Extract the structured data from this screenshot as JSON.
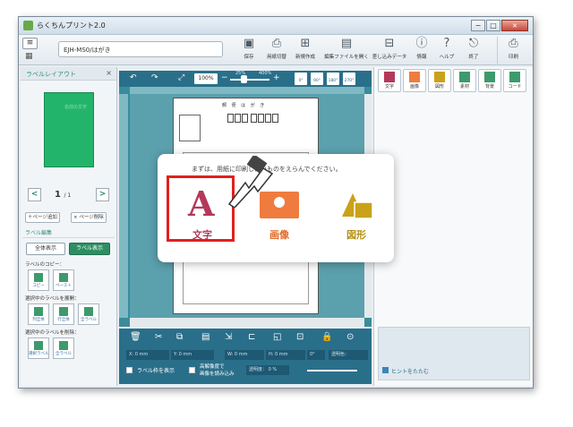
{
  "window": {
    "title": "らくちんプリント2.0",
    "controls": [
      "−",
      "□",
      "×"
    ]
  },
  "toolbar": {
    "media_name": "EJH-MS0/はがき",
    "tools": [
      {
        "label": "保存",
        "icon": "save-icon"
      },
      {
        "label": "用紙切替",
        "icon": "paper-switch-icon"
      },
      {
        "label": "新規作成",
        "icon": "new-file-icon"
      },
      {
        "label": "編集ファイルを開く",
        "icon": "open-file-icon"
      },
      {
        "label": "差し込みデータ",
        "icon": "merge-data-icon"
      },
      {
        "label": "情報",
        "icon": "info-icon"
      },
      {
        "label": "ヘルプ",
        "icon": "help-icon"
      },
      {
        "label": "終了",
        "icon": "exit-icon"
      },
      {
        "label": "印刷",
        "icon": "printer-icon"
      }
    ]
  },
  "left_panel": {
    "title": "ラベルレイアウト",
    "thumb_text": "名前の文字",
    "page_indicator": "1",
    "page_total": "/ 1",
    "add_page": "＋ページ追加",
    "delete_page": "× ページ削除",
    "label_edit_title": "ラベル編集",
    "show_all": "全体表示",
    "show_label": "ラベル表示",
    "label_copy_title": "ラベルのコピー：",
    "copy": "コピー",
    "paste": "ペースト",
    "expand_title": "選択中のラベルを展開：",
    "expand_col": "列全体",
    "expand_row": "行全体",
    "expand_all": "全ラベル",
    "delete_title": "選択中のラベルを削除：",
    "delete_selected": "選択ラベル",
    "delete_all": "全ラベル"
  },
  "canvas": {
    "zoom": "100%",
    "zoom_min": "25%",
    "zoom_max": "400%",
    "rotations": [
      "0°",
      "90°",
      "180°",
      "270°"
    ],
    "paper_title": "郵 便 は が き"
  },
  "bottom_bar": {
    "x_field": "X:     0 mm",
    "y_field": "Y:     0 mm",
    "w_field": "W:     0 mm",
    "h_field": "H:     0 mm",
    "angle_field": "0°",
    "transparent_color": "透明色：",
    "show_label_frame": "ラベル枠を表示",
    "high_density_line1": "高解像度で",
    "high_density_line2": "画像を読み込み",
    "transparency": "透明度：  0 %"
  },
  "right_panel": {
    "tabs": [
      {
        "label": "文字",
        "color": "#b3395b"
      },
      {
        "label": "画像",
        "color": "#f07b3f"
      },
      {
        "label": "図形",
        "color": "#c9a21a"
      },
      {
        "label": "素材",
        "color": "#3d9a6c"
      },
      {
        "label": "背景",
        "color": "#3d9a6c"
      },
      {
        "label": "コード",
        "color": "#3d9a6c"
      }
    ],
    "hint_toggle": "ヒントをたたむ"
  },
  "dialog": {
    "message": "まずは、用紙に印刷したいものをえらんでください。",
    "choices": [
      {
        "label": "文字",
        "color": "#b3395b"
      },
      {
        "label": "画像",
        "color": "#e06a26"
      },
      {
        "label": "図形",
        "color": "#b58f13"
      }
    ]
  }
}
